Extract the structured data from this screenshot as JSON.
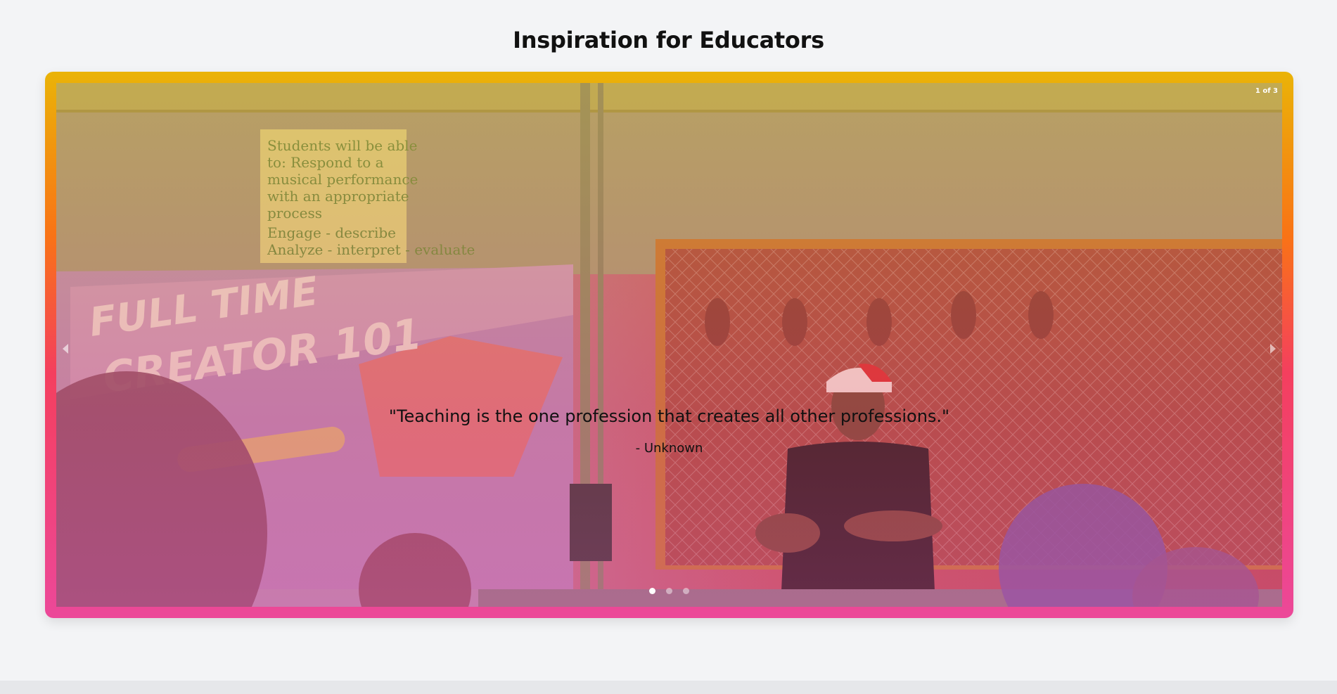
{
  "section": {
    "title": "Inspiration for Educators"
  },
  "carousel": {
    "counter": "1 of 3",
    "current_slide": 1,
    "total_slides": 3,
    "quote": "\"Teaching is the one profession that creates all other professions.\"",
    "attribution": "- Unknown",
    "dots": [
      {
        "active": true
      },
      {
        "active": false
      },
      {
        "active": false
      }
    ],
    "prev_icon": "chevron-left-icon",
    "next_icon": "chevron-right-icon",
    "slide_image": {
      "whiteboard_text": "FULL TIME\nCREATOR 101",
      "poster_text": "Students will be able to: Respond to a musical performance with an appropriate process. Engage - describe, Analyze - interpret - evaluate"
    }
  },
  "colors": {
    "frame_gradient": [
      "#eab308",
      "#f97316",
      "#f43f5e",
      "#ec4899"
    ],
    "page_background": "#f3f4f6",
    "text": "#111111"
  }
}
